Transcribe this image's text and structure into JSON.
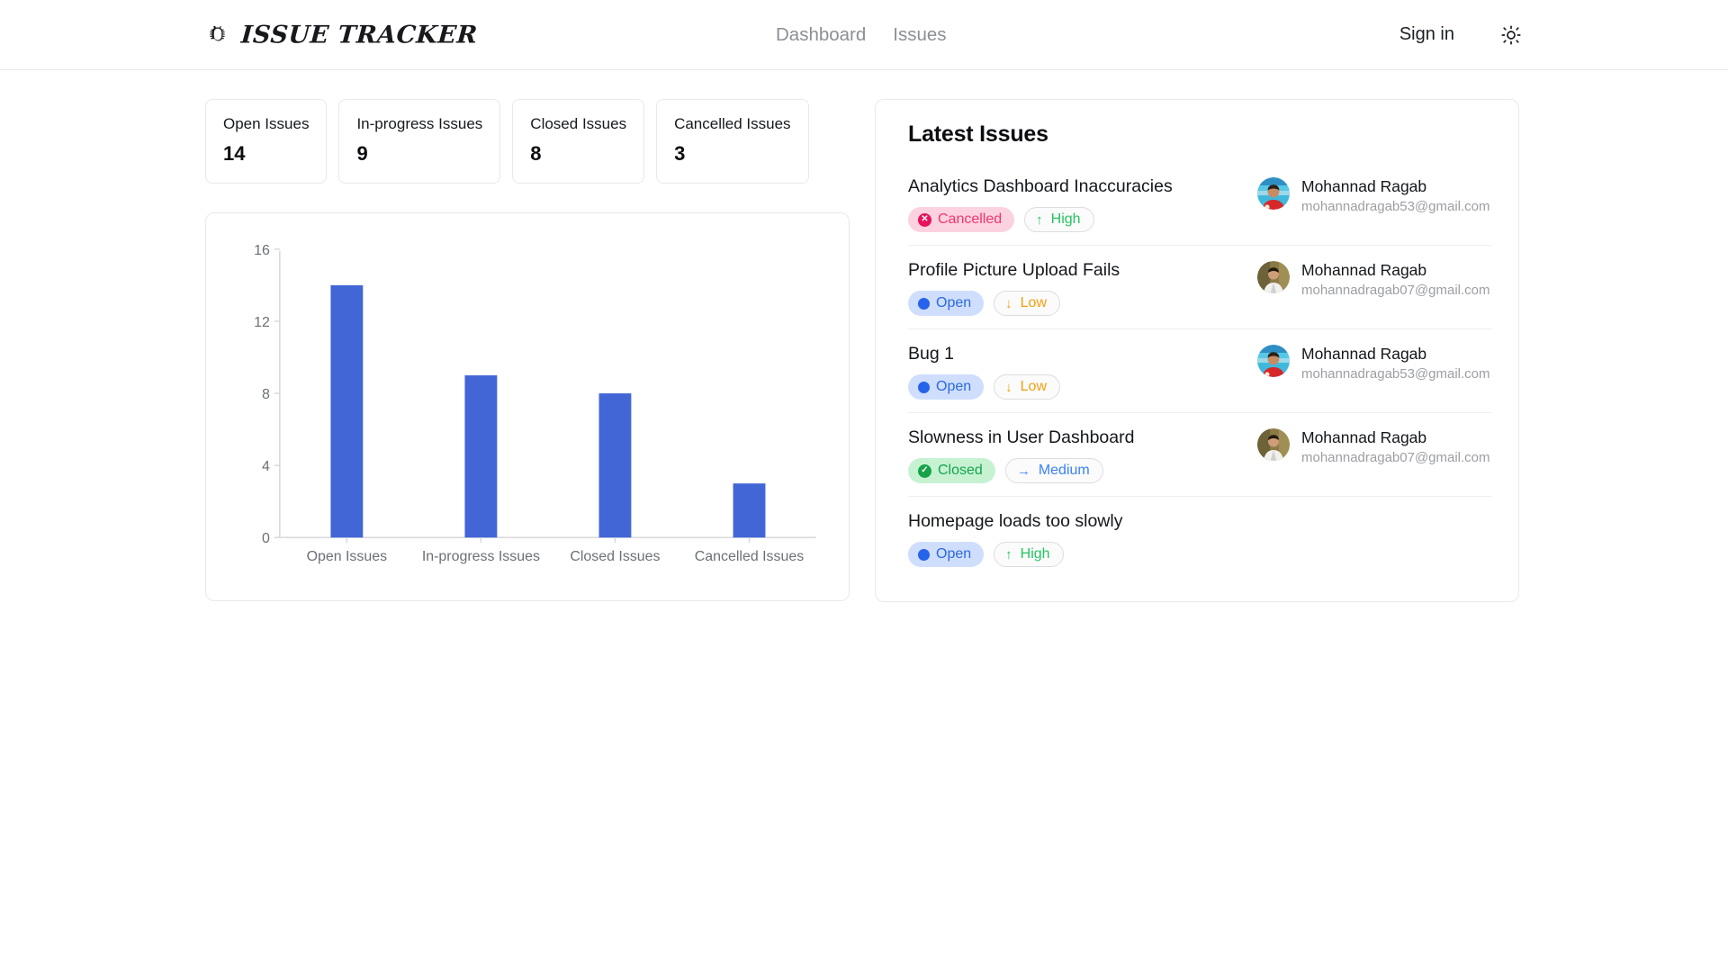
{
  "header": {
    "logo_icon": "bug-icon",
    "brand": "ISSUE TRACKER",
    "nav": [
      {
        "label": "Dashboard"
      },
      {
        "label": "Issues"
      }
    ],
    "signin_label": "Sign in",
    "theme_icon": "sun-icon"
  },
  "stats": [
    {
      "label": "Open Issues",
      "value": "14"
    },
    {
      "label": "In-progress Issues",
      "value": "9"
    },
    {
      "label": "Closed Issues",
      "value": "8"
    },
    {
      "label": "Cancelled Issues",
      "value": "3"
    }
  ],
  "chart_data": {
    "type": "bar",
    "title": "",
    "xlabel": "",
    "ylabel": "",
    "categories": [
      "Open Issues",
      "In-progress Issues",
      "Closed Issues",
      "Cancelled Issues"
    ],
    "values": [
      14,
      9,
      8,
      3
    ],
    "ylim": [
      0,
      16
    ],
    "yticks": [
      0,
      4,
      8,
      12,
      16
    ],
    "grid": false,
    "legend": false,
    "bar_color": "#4266d6",
    "axis_color": "#d8d8dc",
    "tick_label_color": "#6c7076"
  },
  "latest_issues": {
    "title": "Latest Issues",
    "rows": [
      {
        "name": "Analytics Dashboard Inaccuracies",
        "status": "Cancelled",
        "status_kind": "cancelled",
        "status_icon": "x-circle-icon",
        "priority": "High",
        "priority_kind": "high",
        "priority_arrow": "↑",
        "user_name": "Mohannad Ragab",
        "user_email": "mohannadragab53@gmail.com",
        "avatar": "avatar-blue-red"
      },
      {
        "name": "Profile Picture Upload Fails",
        "status": "Open",
        "status_kind": "open",
        "status_icon": "dot-icon",
        "priority": "Low",
        "priority_kind": "low",
        "priority_arrow": "↓",
        "user_name": "Mohannad Ragab",
        "user_email": "mohannadragab07@gmail.com",
        "avatar": "avatar-olive-white"
      },
      {
        "name": "Bug 1",
        "status": "Open",
        "status_kind": "open",
        "status_icon": "dot-icon",
        "priority": "Low",
        "priority_kind": "low",
        "priority_arrow": "↓",
        "user_name": "Mohannad Ragab",
        "user_email": "mohannadragab53@gmail.com",
        "avatar": "avatar-blue-red"
      },
      {
        "name": "Slowness in User Dashboard",
        "status": "Closed",
        "status_kind": "closed",
        "status_icon": "check-circle-icon",
        "priority": "Medium",
        "priority_kind": "medium",
        "priority_arrow": "→",
        "user_name": "Mohannad Ragab",
        "user_email": "mohannadragab07@gmail.com",
        "avatar": "avatar-olive-white"
      },
      {
        "name": "Homepage loads too slowly",
        "status": "Open",
        "status_kind": "open",
        "status_icon": "dot-icon",
        "priority": "High",
        "priority_kind": "high",
        "priority_arrow": "↑",
        "user_name": "",
        "user_email": "",
        "avatar": ""
      }
    ]
  }
}
